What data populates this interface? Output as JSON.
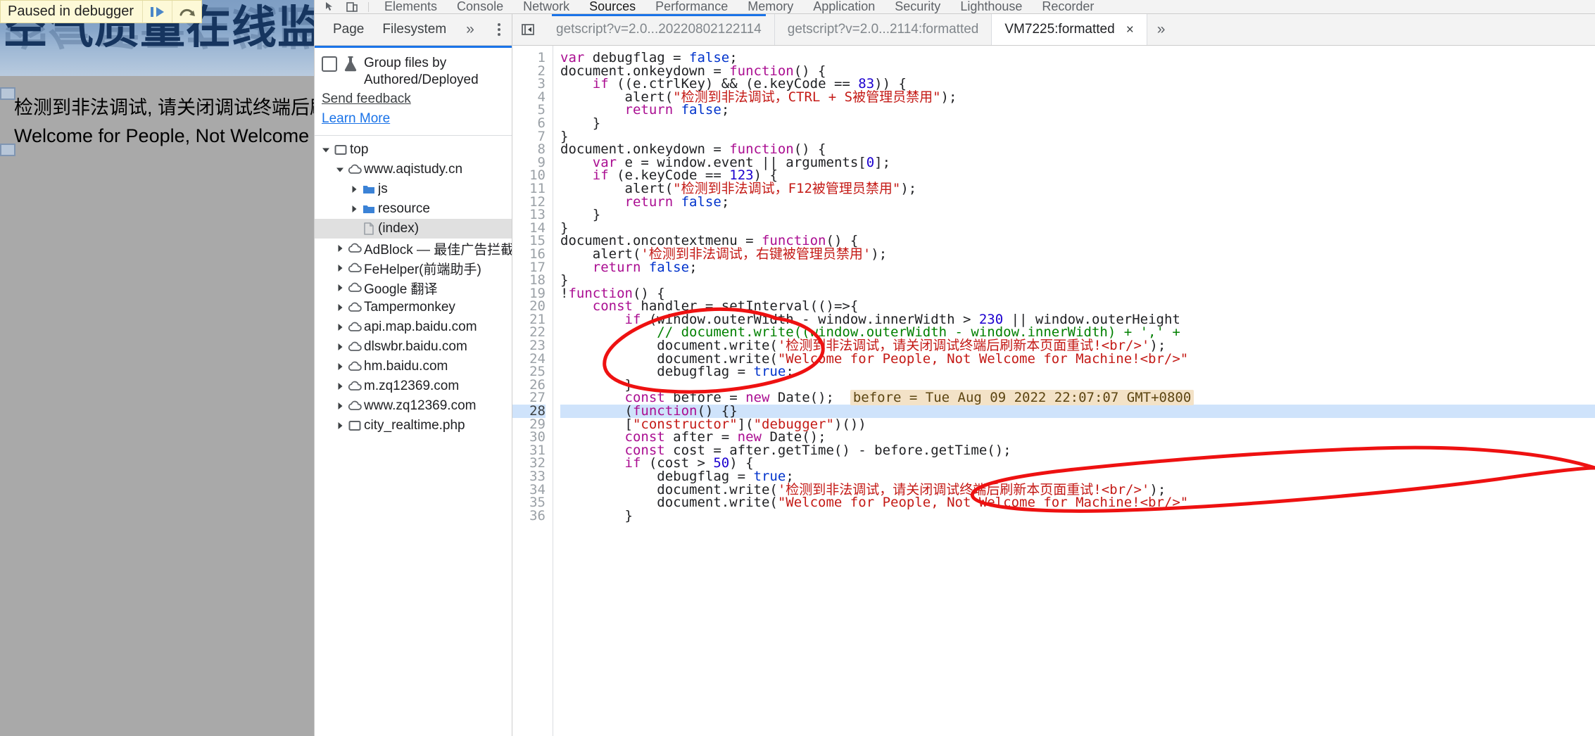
{
  "page": {
    "banner_title": "空气质量在线监测",
    "lines": [
      "检测到非法调试, 请关闭调试终端后刷新本页面重试!",
      "Welcome for People, Not Welcome for Machine!"
    ]
  },
  "paused_overlay": {
    "text": "Paused in debugger",
    "resume_icon": "resume-script-execution-icon",
    "step_icon": "step-over-next-function-call-icon"
  },
  "devtools": {
    "inspect_icon": "inspect-element-icon",
    "device_toolbar_icon": "toggle-device-toolbar-icon",
    "tabs": [
      {
        "label": "Elements",
        "active": false
      },
      {
        "label": "Console",
        "active": false
      },
      {
        "label": "Network",
        "active": false
      },
      {
        "label": "Sources",
        "active": true
      },
      {
        "label": "Performance",
        "active": false
      },
      {
        "label": "Memory",
        "active": false
      },
      {
        "label": "Application",
        "active": false
      },
      {
        "label": "Security",
        "active": false
      },
      {
        "label": "Lighthouse",
        "active": false
      },
      {
        "label": "Recorder",
        "active": false
      }
    ],
    "navigator": {
      "subtabs": [
        {
          "label": "Page"
        },
        {
          "label": "Filesystem"
        }
      ],
      "more_label": "»",
      "kebab_icon": "more-options-icon",
      "banner": {
        "checkbox_checked": false,
        "flask_icon": "experiment-flask-icon",
        "label": "Group files by Authored/Deployed",
        "feedback_link": "Send feedback",
        "learn_link": "Learn More"
      },
      "tree": [
        {
          "label": "top",
          "indent": 0,
          "twisty": "open",
          "icon": "frame-icon",
          "selected": false
        },
        {
          "label": "www.aqistudy.cn",
          "indent": 1,
          "twisty": "open",
          "icon": "cloud-icon",
          "selected": false
        },
        {
          "label": "js",
          "indent": 2,
          "twisty": "closed",
          "icon": "folder-icon",
          "selected": false
        },
        {
          "label": "resource",
          "indent": 2,
          "twisty": "closed",
          "icon": "folder-icon",
          "selected": false
        },
        {
          "label": "(index)",
          "indent": 2,
          "twisty": "none",
          "icon": "document-icon",
          "selected": true
        },
        {
          "label": "AdBlock — 最佳广告拦截工具",
          "indent": 1,
          "twisty": "closed",
          "icon": "cloud-icon",
          "selected": false
        },
        {
          "label": "FeHelper(前端助手)",
          "indent": 1,
          "twisty": "closed",
          "icon": "cloud-icon",
          "selected": false
        },
        {
          "label": "Google 翻译",
          "indent": 1,
          "twisty": "closed",
          "icon": "cloud-icon",
          "selected": false
        },
        {
          "label": "Tampermonkey",
          "indent": 1,
          "twisty": "closed",
          "icon": "cloud-icon",
          "selected": false
        },
        {
          "label": "api.map.baidu.com",
          "indent": 1,
          "twisty": "closed",
          "icon": "cloud-icon",
          "selected": false
        },
        {
          "label": "dlswbr.baidu.com",
          "indent": 1,
          "twisty": "closed",
          "icon": "cloud-icon",
          "selected": false
        },
        {
          "label": "hm.baidu.com",
          "indent": 1,
          "twisty": "closed",
          "icon": "cloud-icon",
          "selected": false
        },
        {
          "label": "m.zq12369.com",
          "indent": 1,
          "twisty": "closed",
          "icon": "cloud-icon",
          "selected": false
        },
        {
          "label": "www.zq12369.com",
          "indent": 1,
          "twisty": "closed",
          "icon": "cloud-icon",
          "selected": false
        },
        {
          "label": "city_realtime.php",
          "indent": 1,
          "twisty": "closed",
          "icon": "frame-icon",
          "selected": false
        }
      ]
    },
    "jump_to_previous_icon": "jump-to-previous-location-icon",
    "file_tabs": [
      {
        "label": "getscript?v=2.0...20220802122114",
        "active": false,
        "underline": true,
        "closable": false
      },
      {
        "label": "getscript?v=2.0...2114:formatted",
        "active": false,
        "underline": false,
        "closable": false
      },
      {
        "label": "VM7225:formatted",
        "active": true,
        "underline": false,
        "closable": true
      }
    ],
    "tab_close_glyph": "×",
    "tabs_overflow_glyph": "»",
    "editor": {
      "highlighted_line": 28,
      "inline_value": "before = Tue Aug 09 2022 22:07:07 GMT+0800",
      "first_line": 1,
      "last_line": 36,
      "lines": [
        "var debugflag = false;",
        "document.onkeydown = function() {",
        "    if ((e.ctrlKey) && (e.keyCode == 83)) {",
        "        alert(\"检测到非法调试，CTRL + S被管理员禁用\");",
        "        return false;",
        "    }",
        "}",
        "document.onkeydown = function() {",
        "    var e = window.event || arguments[0];",
        "    if (e.keyCode == 123) {",
        "        alert(\"检测到非法调试，F12被管理员禁用\");",
        "        return false;",
        "    }",
        "}",
        "document.oncontextmenu = function() {",
        "    alert('检测到非法调试，右键被管理员禁用');",
        "    return false;",
        "}",
        "!function() {",
        "    const handler = setInterval(()=>{",
        "        if (window.outerWidth - window.innerWidth > 230 || window.outerHeight",
        "            // document.write((window.outerWidth - window.innerWidth) + ',' +",
        "            document.write('检测到非法调试，请关闭调试终端后刷新本页面重试!<br/>');",
        "            document.write(\"Welcome for People, Not Welcome for Machine!<br/>\"",
        "            debugflag = true;",
        "        }",
        "        const before = new Date();",
        "        (function() {}",
        "        [\"constructor\"](\"debugger\")())",
        "        const after = new Date();",
        "        const cost = after.getTime() - before.getTime();",
        "        if (cost > 50) {",
        "            debugflag = true;",
        "            document.write('检测到非法调试，请关闭调试终端后刷新本页面重试!<br/>');",
        "            document.write(\"Welcome for People, Not Welcome for Machine!<br/>\"",
        "        }"
      ]
    }
  },
  "annotations": {
    "ellipse_1": "red-hand-drawn-ellipse-around-setInterval",
    "ellipse_2": "red-hand-drawn-ellipse-around-cost-check"
  },
  "colors": {
    "accent": "#1a73e8",
    "paused_bg": "#fdf9d7",
    "annotation_red": "#ee1111",
    "highlight_line": "#cfe3fb",
    "inline_value_bg": "#f3e2c7"
  }
}
